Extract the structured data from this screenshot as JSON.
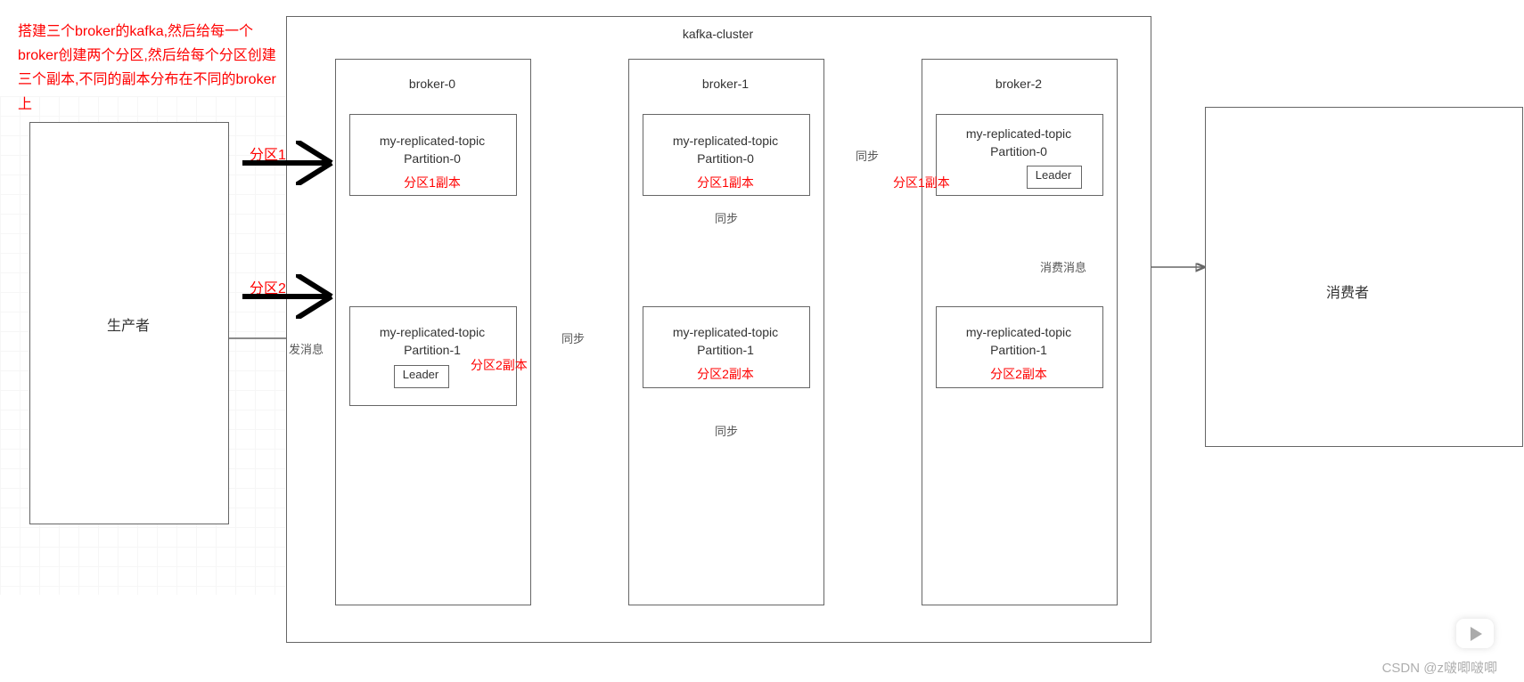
{
  "description": "搭建三个broker的kafka,然后给每一个broker创建两个分区,然后给每个分区创建三个副本,不同的副本分布在不同的broker上",
  "cluster_title": "kafka-cluster",
  "producer_label": "生产者",
  "consumer_label": "消费者",
  "brokers": [
    {
      "name": "broker-0",
      "partitions": [
        {
          "topic": "my-replicated-topic",
          "partition": "Partition-0",
          "replica_label": "分区1副本",
          "leader": null
        },
        {
          "topic": "my-replicated-topic",
          "partition": "Partition-1",
          "replica_label": "分区2副本",
          "leader": "Leader"
        }
      ]
    },
    {
      "name": "broker-1",
      "partitions": [
        {
          "topic": "my-replicated-topic",
          "partition": "Partition-0",
          "replica_label": "分区1副本",
          "leader": null
        },
        {
          "topic": "my-replicated-topic",
          "partition": "Partition-1",
          "replica_label": "分区2副本",
          "leader": null
        }
      ]
    },
    {
      "name": "broker-2",
      "partitions": [
        {
          "topic": "my-replicated-topic",
          "partition": "Partition-0",
          "replica_label": "分区1副本",
          "leader": "Leader"
        },
        {
          "topic": "my-replicated-topic",
          "partition": "Partition-1",
          "replica_label": "分区2副本",
          "leader": null
        }
      ]
    }
  ],
  "arrow_labels": {
    "zone1": "分区1",
    "zone2": "分区2"
  },
  "edge_labels": {
    "send": "发消息",
    "sync": "同步",
    "consume": "消费消息"
  },
  "watermark": "CSDN @z啵唧啵唧"
}
